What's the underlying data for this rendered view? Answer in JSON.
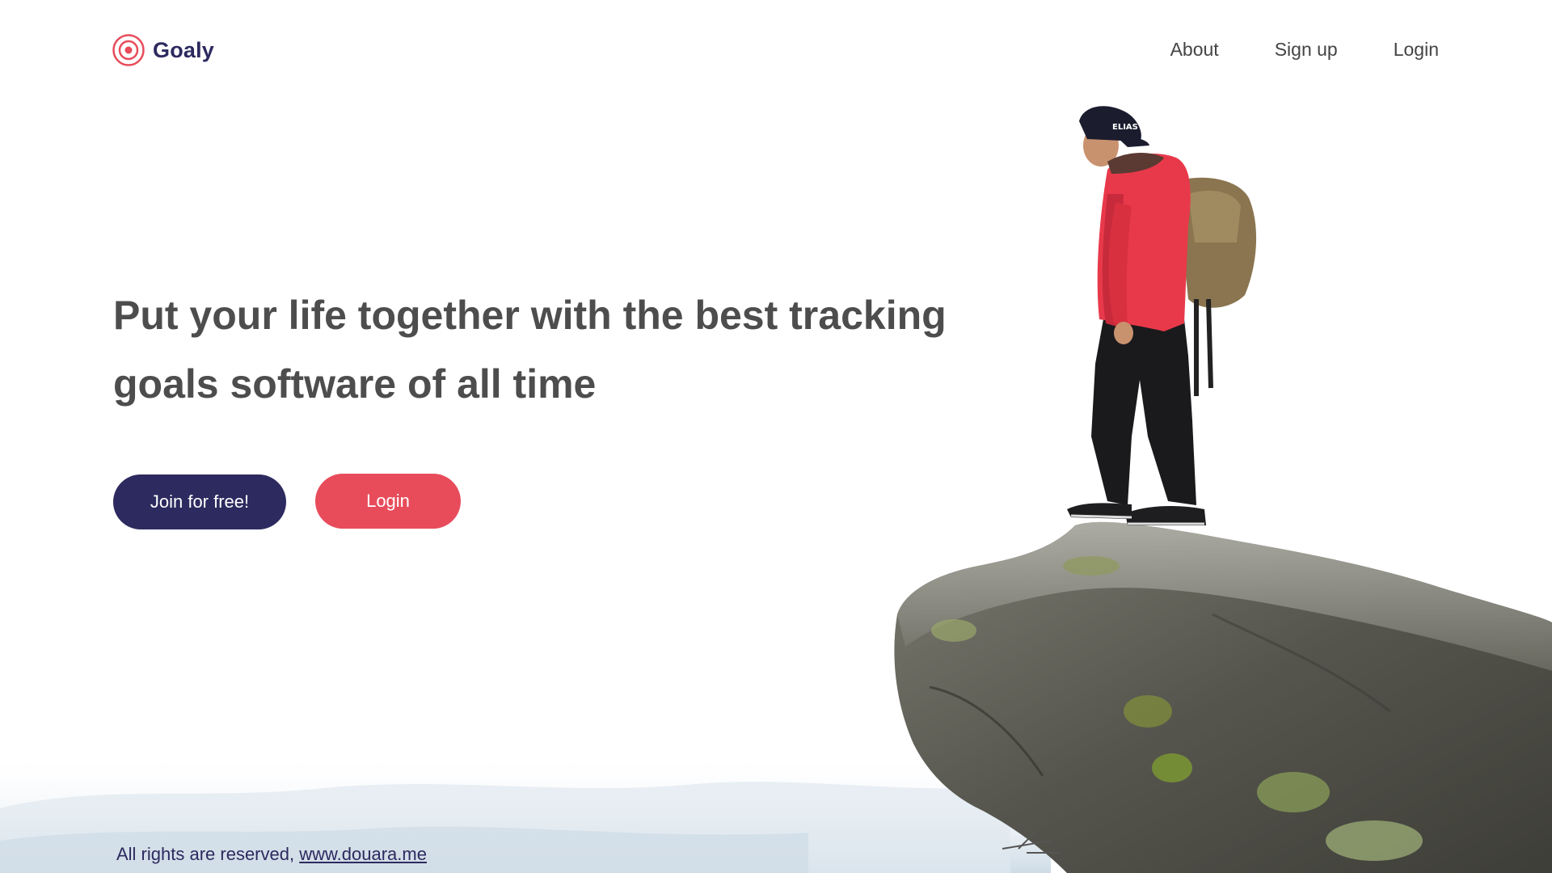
{
  "header": {
    "brand": "Goaly",
    "nav": [
      {
        "label": "About"
      },
      {
        "label": "Sign up"
      },
      {
        "label": "Login"
      }
    ]
  },
  "hero": {
    "headline": "Put your life together with the best tracking goals software of all time",
    "join_button": "Join for free!",
    "login_button": "Login"
  },
  "footer": {
    "text": "All rights are reserved,",
    "link": "www.douara.me"
  },
  "colors": {
    "brand_navy": "#2d2a5f",
    "accent_red": "#e84c5b",
    "headline_gray": "#4d4d4d"
  },
  "icons": {
    "logo": "target-icon"
  }
}
